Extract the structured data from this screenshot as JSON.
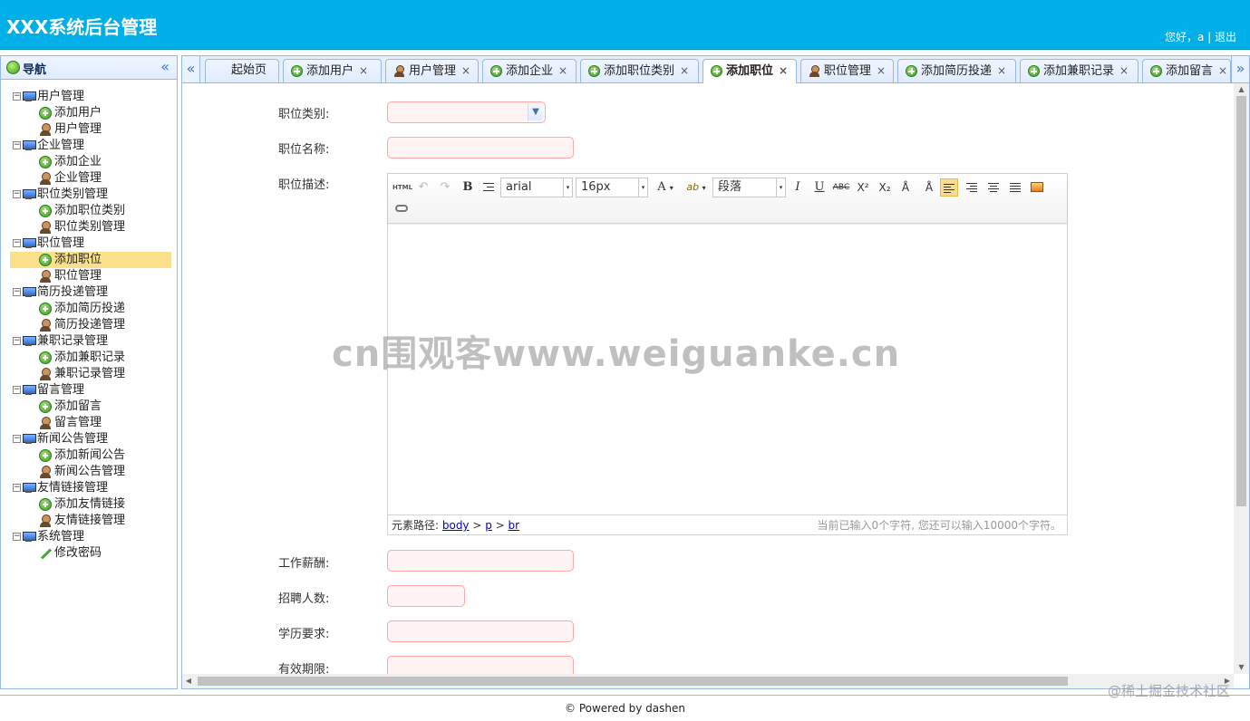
{
  "header": {
    "title": "XXX系统后台管理",
    "greeting": "您好，a",
    "separator": " | ",
    "logout": "退出"
  },
  "nav": {
    "title": "导航",
    "collapse_glyph": "«",
    "groups": [
      {
        "label": "用户管理",
        "items": [
          {
            "label": "添加用户",
            "icon": "add-icon"
          },
          {
            "label": "用户管理",
            "icon": "user-icon"
          }
        ]
      },
      {
        "label": "企业管理",
        "items": [
          {
            "label": "添加企业",
            "icon": "add-icon"
          },
          {
            "label": "企业管理",
            "icon": "user-icon"
          }
        ]
      },
      {
        "label": "职位类别管理",
        "items": [
          {
            "label": "添加职位类别",
            "icon": "add-icon"
          },
          {
            "label": "职位类别管理",
            "icon": "user-icon"
          }
        ]
      },
      {
        "label": "职位管理",
        "items": [
          {
            "label": "添加职位",
            "icon": "add-icon",
            "selected": true
          },
          {
            "label": "职位管理",
            "icon": "user-icon"
          }
        ]
      },
      {
        "label": "简历投递管理",
        "items": [
          {
            "label": "添加简历投递",
            "icon": "add-icon"
          },
          {
            "label": "简历投递管理",
            "icon": "user-icon"
          }
        ]
      },
      {
        "label": "兼职记录管理",
        "items": [
          {
            "label": "添加兼职记录",
            "icon": "add-icon"
          },
          {
            "label": "兼职记录管理",
            "icon": "user-icon"
          }
        ]
      },
      {
        "label": "留言管理",
        "items": [
          {
            "label": "添加留言",
            "icon": "add-icon"
          },
          {
            "label": "留言管理",
            "icon": "user-icon"
          }
        ]
      },
      {
        "label": "新闻公告管理",
        "items": [
          {
            "label": "添加新闻公告",
            "icon": "add-icon"
          },
          {
            "label": "新闻公告管理",
            "icon": "user-icon"
          }
        ]
      },
      {
        "label": "友情链接管理",
        "items": [
          {
            "label": "添加友情链接",
            "icon": "add-icon"
          },
          {
            "label": "友情链接管理",
            "icon": "user-icon"
          }
        ]
      },
      {
        "label": "系统管理",
        "items": [
          {
            "label": "修改密码",
            "icon": "pencil-icon"
          }
        ]
      }
    ]
  },
  "tabs": {
    "scroll_left": "«",
    "scroll_right": "»",
    "close_glyph": "×",
    "items": [
      {
        "label": "起始页",
        "icon": "none",
        "closable": false
      },
      {
        "label": "添加用户",
        "icon": "add-icon",
        "closable": true
      },
      {
        "label": "用户管理",
        "icon": "user-icon",
        "closable": true
      },
      {
        "label": "添加企业",
        "icon": "add-icon",
        "closable": true
      },
      {
        "label": "添加职位类别",
        "icon": "add-icon",
        "closable": true
      },
      {
        "label": "添加职位",
        "icon": "add-icon",
        "closable": true,
        "active": true
      },
      {
        "label": "职位管理",
        "icon": "user-icon",
        "closable": true
      },
      {
        "label": "添加简历投递",
        "icon": "add-icon",
        "closable": true
      },
      {
        "label": "添加兼职记录",
        "icon": "add-icon",
        "closable": true
      },
      {
        "label": "添加留言",
        "icon": "add-icon",
        "closable": true
      }
    ]
  },
  "form": {
    "category_label": "职位类别:",
    "category_value": "",
    "name_label": "职位名称:",
    "name_value": "",
    "desc_label": "职位描述:",
    "salary_label": "工作薪酬:",
    "salary_value": "",
    "headcount_label": "招聘人数:",
    "headcount_value": "",
    "education_label": "学历要求:",
    "education_value": "",
    "validity_label": "有效期限:",
    "validity_value": ""
  },
  "editor": {
    "toolbar": {
      "html": "HTML",
      "undo": "↶",
      "redo": "↷",
      "bold": "B",
      "font_family": "arial",
      "font_size": "16px",
      "font_color": "A",
      "back_color": "ab",
      "paragraph": "段落",
      "italic": "I",
      "underline": "U",
      "strike": "ABC",
      "superscript": "X²",
      "subscript": "X₂",
      "combo_arrow": "▾"
    },
    "status": {
      "path_label": "元素路径: ",
      "path_body": "body",
      "path_sep": " > ",
      "path_p": "p",
      "path_br": "br",
      "count_text": "当前已输入0个字符, 您还可以输入10000个字符。"
    }
  },
  "watermark": "cn围观客www.weiguanke.cn",
  "footer": {
    "text": "© Powered by dashen"
  },
  "corner_mark": "@稀土掘金技术社区",
  "colors": {
    "header_bg": "#00aee8",
    "border": "#95b8e7",
    "selected_bg": "#fbe08b",
    "required_input_bg": "#fff3f3",
    "required_input_border": "#ffa8a8"
  }
}
